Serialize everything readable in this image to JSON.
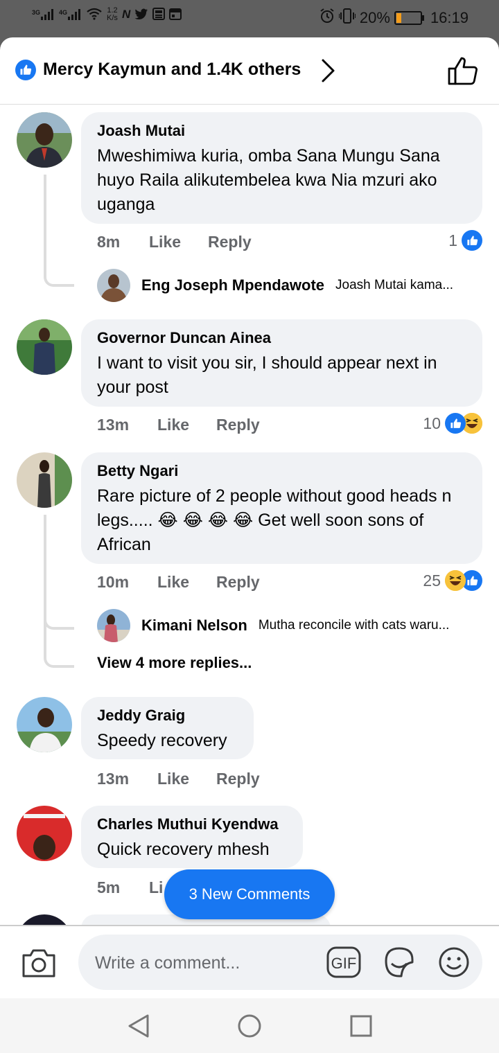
{
  "status_bar": {
    "net_gen1": "3G",
    "net_gen2": "4G",
    "speed": "1.2",
    "speed_unit": "K/s",
    "app_icons": [
      "N",
      "twitter-icon",
      "news-icon",
      "calendar-icon"
    ],
    "battery": "20%",
    "battery_level": 0.2,
    "time": "16:19"
  },
  "header": {
    "title": "Mercy Kaymun and 1.4K others"
  },
  "comments": [
    {
      "name": "Joash Mutai",
      "text": "Mweshimiwa kuria, omba Sana Mungu Sana huyo Raila alikutembelea kwa Nia mzuri ako uganga",
      "time": "8m",
      "like": "Like",
      "reply": "Reply",
      "reaction_count": "1",
      "reply_preview": {
        "name": "Eng Joseph Mpendawote",
        "text": "Joash Mutai kama..."
      }
    },
    {
      "name": "Governor Duncan Ainea",
      "text": "I want to visit you sir, I should appear next in your post",
      "time": "13m",
      "like": "Like",
      "reply": "Reply",
      "reaction_count": "10"
    },
    {
      "name": "Betty Ngari",
      "text": "Rare picture of 2 people without good heads n legs..... 😂 😂 😂 😂 Get well soon sons of African",
      "time": "10m",
      "like": "Like",
      "reply": "Reply",
      "reaction_count": "25",
      "reply_preview": {
        "name": "Kimani Nelson",
        "text": "Mutha reconcile with cats waru..."
      },
      "more_replies": "View 4 more replies..."
    },
    {
      "name": "Jeddy Graig",
      "text": "Speedy recovery",
      "time": "13m",
      "like": "Like",
      "reply": "Reply"
    },
    {
      "name": "Charles Muthui Kyendwa",
      "text": "Quick recovery mhesh",
      "time": "5m",
      "like": "Li"
    }
  ],
  "new_comments_button": "3 New Comments",
  "composer": {
    "placeholder": "Write a comment...",
    "gif_label": "GIF"
  },
  "colors": {
    "accent": "#1877f2",
    "bubble": "#f0f2f5",
    "meta_text": "#65676b",
    "haha": "#f7c23b"
  }
}
